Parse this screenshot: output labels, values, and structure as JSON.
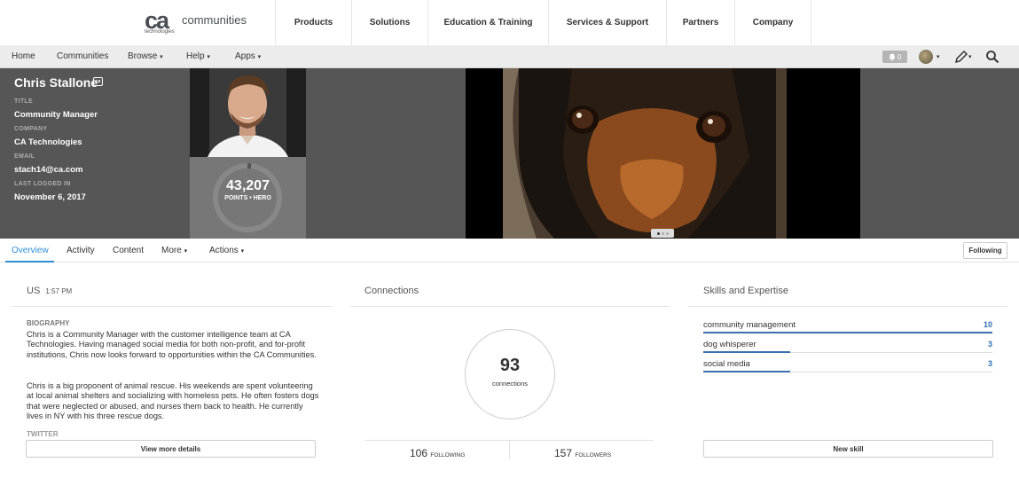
{
  "brand": {
    "logo_mark": "ca",
    "logo_sub": "technologies",
    "site_name": "communities"
  },
  "main_menu": [
    "Products",
    "Solutions",
    "Education & Training",
    "Services & Support",
    "Partners",
    "Company"
  ],
  "sub_nav": {
    "home": "Home",
    "communities": "Communities",
    "browse": "Browse",
    "help": "Help",
    "apps": "Apps",
    "caret": "▾"
  },
  "notifications": {
    "count": "0"
  },
  "profile": {
    "name": "Chris Stallone",
    "badge": "ca",
    "fields": [
      {
        "label": "TITLE",
        "value": "Community Manager"
      },
      {
        "label": "COMPANY",
        "value": "CA Technologies"
      },
      {
        "label": "EMAIL",
        "value": "stach14@ca.com"
      },
      {
        "label": "LAST LOGGED IN",
        "value": "November 6, 2017"
      }
    ],
    "points": "43,207",
    "points_label": "POINTS • HERO"
  },
  "cover": {
    "slides_total": 3,
    "slide_active": 1
  },
  "tabs": {
    "overview": "Overview",
    "activity": "Activity",
    "content": "Content",
    "more": "More",
    "actions": "Actions",
    "following_button": "Following"
  },
  "overview": {
    "location": "US",
    "local_time": "1:57 PM",
    "biography_label": "BIOGRAPHY",
    "bio_p1": "Chris is a Community Manager with the customer intelligence team at CA Technologies. Having managed social media for both non-profit, and for-profit institutions, Chris now looks forward to opportunities within the CA Communities.",
    "bio_p2": "Chris is a big proponent of animal rescue. His weekends are spent volunteering at local animal shelters and socializing with homeless pets. He often fosters dogs that were neglected or abused, and nurses them back to health. He currently lives in NY with his three rescue dogs.",
    "twitter_label": "TWITTER",
    "view_more": "View more details"
  },
  "connections": {
    "title": "Connections",
    "count": "93",
    "count_label": "connections",
    "following": "106",
    "following_label": "FOLLOWING",
    "followers": "157",
    "followers_label": "FOLLOWERS"
  },
  "skills": {
    "title": "Skills and Expertise",
    "items": [
      {
        "name": "community management",
        "count": "10",
        "level": 1.0
      },
      {
        "name": "dog whisperer",
        "count": "3",
        "level": 0.3
      },
      {
        "name": "social media",
        "count": "3",
        "level": 0.3
      }
    ],
    "new_skill": "New skill"
  },
  "colors": {
    "accent": "#2f8fd8",
    "banner": "#565656",
    "skill_bar": "#3a6fb0"
  }
}
